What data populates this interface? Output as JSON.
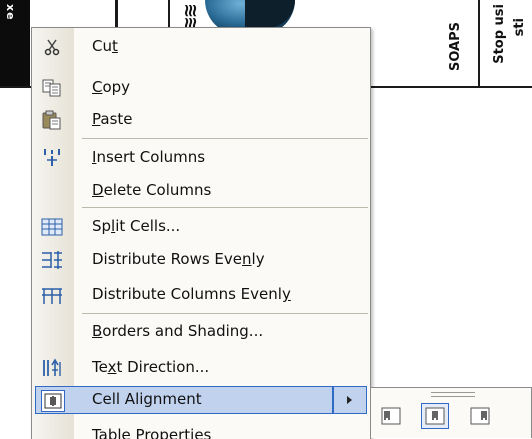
{
  "document": {
    "black_text": "xe",
    "rotated_text_1": "SOAPS",
    "rotated_text_2": "Stop usi",
    "rotated_text_3": "sti"
  },
  "context_menu": {
    "items": [
      {
        "name": "cut",
        "pre": "Cu",
        "key": "t",
        "post": "",
        "icon": "scissors-icon"
      },
      {
        "name": "copy",
        "pre": "",
        "key": "C",
        "post": "opy",
        "icon": "copy-icon"
      },
      {
        "name": "paste",
        "pre": "",
        "key": "P",
        "post": "aste",
        "icon": "paste-icon"
      },
      {
        "name": "insert-columns",
        "pre": "",
        "key": "I",
        "post": "nsert Columns",
        "icon": "insert-columns-icon"
      },
      {
        "name": "delete-columns",
        "pre": "",
        "key": "D",
        "post": "elete Columns",
        "icon": ""
      },
      {
        "name": "split-cells",
        "pre": "Sp",
        "key": "l",
        "post": "it Cells...",
        "icon": "split-cells-icon"
      },
      {
        "name": "distribute-rows",
        "pre": "Distribute Rows Eve",
        "key": "n",
        "post": "ly",
        "icon": "distribute-rows-icon"
      },
      {
        "name": "distribute-columns",
        "pre": "Distribute Columns Evenl",
        "key": "y",
        "post": "",
        "icon": "distribute-columns-icon"
      },
      {
        "name": "borders-shading",
        "pre": "",
        "key": "B",
        "post": "orders and Shading...",
        "icon": ""
      },
      {
        "name": "text-direction",
        "pre": "Te",
        "key": "x",
        "post": "t Direction...",
        "icon": "text-direction-icon"
      },
      {
        "name": "cell-alignment",
        "pre": "Cell Alignment",
        "key": "",
        "post": "",
        "icon": "cell-alignment-icon"
      },
      {
        "name": "table-properties",
        "pre": "Table Properties",
        "key": "",
        "post": "",
        "icon": ""
      }
    ]
  },
  "submenu": {
    "buttons": [
      "align-left",
      "align-center",
      "align-right"
    ]
  },
  "colors": {
    "highlight": "#c1d2ee",
    "highlight_border": "#316ac5"
  }
}
